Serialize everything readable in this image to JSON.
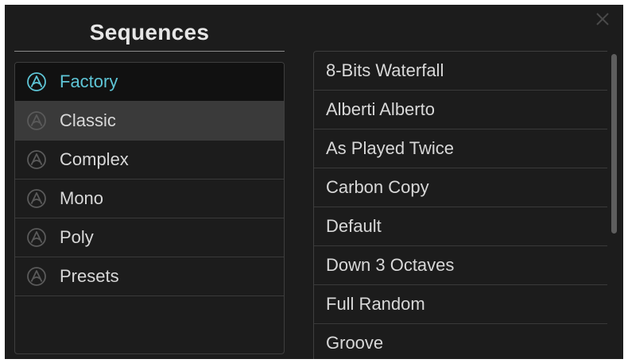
{
  "dialog": {
    "title": "Sequences"
  },
  "categories": [
    {
      "label": "Factory",
      "state": "selected"
    },
    {
      "label": "Classic",
      "state": "hover"
    },
    {
      "label": "Complex",
      "state": "normal"
    },
    {
      "label": "Mono",
      "state": "normal"
    },
    {
      "label": "Poly",
      "state": "normal"
    },
    {
      "label": "Presets",
      "state": "normal"
    }
  ],
  "sequences": [
    "8-Bits Waterfall",
    "Alberti Alberto",
    "As Played Twice",
    "Carbon Copy",
    "Default",
    "Down 3 Octaves",
    "Full Random",
    "Groove"
  ],
  "icons": {
    "close": "close-icon",
    "category": "arturia-logo-icon"
  },
  "colors": {
    "background": "#1c1c1c",
    "accent": "#5ec5d6",
    "text": "#d8d8d8",
    "selected_bg": "#111111",
    "hover_bg": "#3a3a3a"
  }
}
